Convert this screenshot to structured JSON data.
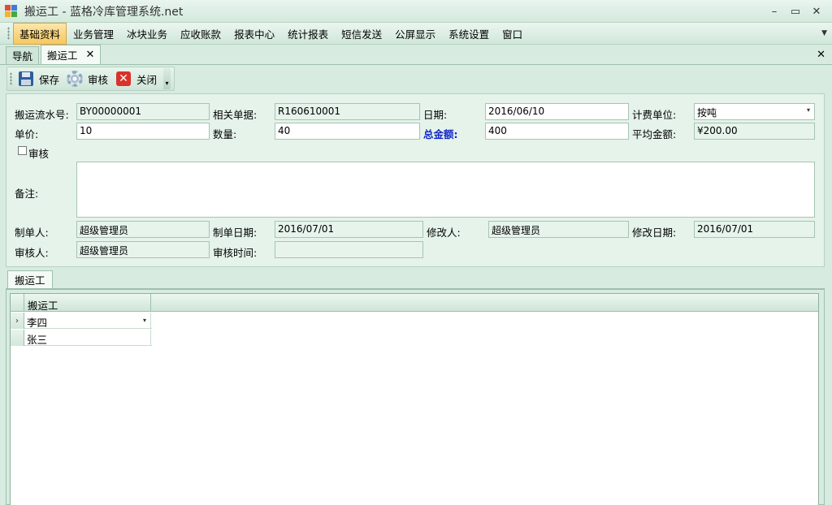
{
  "window": {
    "title": "搬运工 - 蓝格冷库管理系统.net",
    "minimize": "–",
    "maximize": "▭",
    "close": "✕"
  },
  "menu": {
    "items": [
      "基础资料",
      "业务管理",
      "冰块业务",
      "应收账款",
      "报表中心",
      "统计报表",
      "短信发送",
      "公屏显示",
      "系统设置",
      "窗口"
    ],
    "active_index": 0,
    "overflow_glyph": "▼"
  },
  "doc_tabs": {
    "items": [
      "导航",
      "搬运工"
    ],
    "active_index": 1,
    "tab_close": "✕",
    "area_close": "✕"
  },
  "toolbar": {
    "save": "保存",
    "audit": "审核",
    "close": "关闭",
    "close_glyph": "✕",
    "overflow_glyph": "▾"
  },
  "form": {
    "serial_label": "搬运流水号:",
    "serial_value": "BY00000001",
    "related_label": "相关单据:",
    "related_value": "R160610001",
    "date_label": "日期:",
    "date_value": "2016/06/10",
    "billing_unit_label": "计费单位:",
    "billing_unit_value": "按吨",
    "price_label": "单价:",
    "price_value": "10",
    "quantity_label": "数量:",
    "quantity_value": "40",
    "total_label": "总金额:",
    "total_value": "400",
    "avg_label": "平均金额:",
    "avg_value": "¥200.00",
    "audit_check_label": "审核",
    "remark_label": "备注:",
    "remark_value": "",
    "creator_label": "制单人:",
    "creator_value": "超级管理员",
    "create_date_label": "制单日期:",
    "create_date_value": "2016/07/01",
    "modifier_label": "修改人:",
    "modifier_value": "超级管理员",
    "modify_date_label": "修改日期:",
    "modify_date_value": "2016/07/01",
    "auditor_label": "审核人:",
    "auditor_value": "超级管理员",
    "audit_time_label": "审核时间:",
    "audit_time_value": ""
  },
  "detail_tabs": {
    "items": [
      "搬运工"
    ]
  },
  "grid": {
    "columns": [
      "搬运工"
    ],
    "rows": [
      {
        "worker": "李四",
        "current": true
      },
      {
        "worker": "张三",
        "current": false
      }
    ],
    "current_row_glyph": "›",
    "dropdown_glyph": "▾"
  },
  "colors": {
    "accent_blue": "#1428c8",
    "panel_green": "#e5f3ea",
    "menu_active": "#f6c860"
  }
}
